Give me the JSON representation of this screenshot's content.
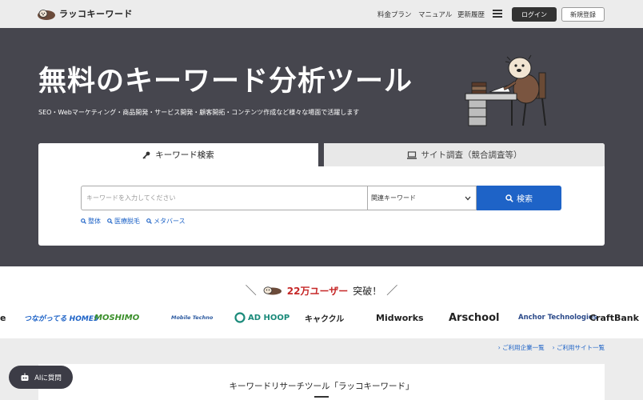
{
  "header": {
    "logo_text": "ラッコキーワード",
    "nav": [
      "料金プラン",
      "マニュアル",
      "更新履歴"
    ],
    "login_label": "ログイン",
    "register_label": "新規登録"
  },
  "hero": {
    "title": "無料のキーワード分析ツール",
    "subtitle": "SEO・Webマーケティング・商品開発・サービス開発・顧客開拓・コンテンツ作成など様々な場面で活躍します"
  },
  "search": {
    "tabs": [
      {
        "label": "キーワード検索",
        "icon": "key-icon",
        "active": true
      },
      {
        "label": "サイト調査（競合調査等）",
        "icon": "monitor-icon",
        "active": false
      }
    ],
    "placeholder": "キーワードを入力してください",
    "select_value": "関連キーワード",
    "button_label": "検索",
    "quick_links": [
      "整体",
      "医療脱毛",
      "メタバース"
    ]
  },
  "users": {
    "count": "22万ユーザー",
    "suffix": "突破！"
  },
  "client_logos": [
    "e",
    "つながってる HOME5",
    "MOSHIMO",
    "Mobile Techno",
    "AD HOOP",
    "キャククル",
    "Midworks",
    "Arschool",
    "Anchor Technologies",
    "CraftBank"
  ],
  "lower": {
    "links": [
      "ご利用企業一覧",
      "ご利用サイト一覧"
    ],
    "section_title": "キーワードリサーチツール「ラッコキーワード」"
  },
  "ai_button_label": "AIに質問",
  "colors": {
    "hero_bg": "#46464e",
    "accent_blue": "#1e63c7",
    "user_count_red": "#c62828"
  }
}
